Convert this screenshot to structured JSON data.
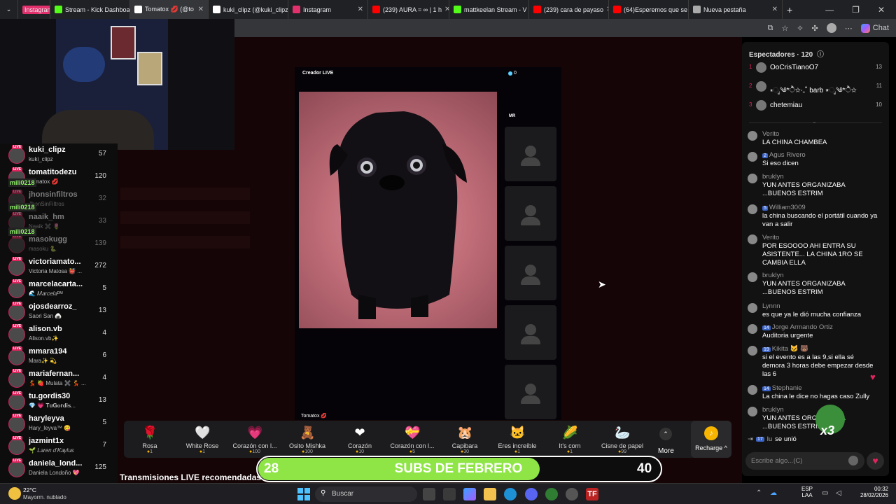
{
  "browser": {
    "tabs": [
      {
        "label": "Instagram",
        "color": "#e1306c",
        "badge": true
      },
      {
        "label": "Stream - Kick Dashboa",
        "color": "#53fc18"
      },
      {
        "label": "Tomatox 💋 (@to",
        "color": "#ffffff",
        "active": true
      },
      {
        "label": "kuki_clipz (@kuki_clipz",
        "color": "#ffffff"
      },
      {
        "label": "Instagram",
        "color": "#e1306c"
      },
      {
        "label": "(239) AURA = ∞ | 1 h",
        "color": "#ff0000"
      },
      {
        "label": "mattkeelan Stream - V",
        "color": "#53fc18"
      },
      {
        "label": "(239) cara de payaso",
        "color": "#ff0000"
      },
      {
        "label": "(64)Esperemos que se",
        "color": "#ff0000"
      },
      {
        "label": "Nueva pestaña",
        "color": "#aaaaaa"
      }
    ],
    "chat_button": "Chat"
  },
  "streamers": [
    {
      "name": "kuki_clipz",
      "sub": "kuki_clipz",
      "count": "57"
    },
    {
      "name": "tomatitodezu",
      "sub": "Tomatox 💋",
      "count": "120"
    },
    {
      "name": "jhonsinfiltros",
      "sub": "JhonSinFiltros",
      "count": "32",
      "dim": true
    },
    {
      "name": "naaik_hm",
      "sub": "Naaik ✖️ 🌷",
      "count": "33",
      "dim": true
    },
    {
      "name": "masokugg",
      "sub": "masoku 🐍",
      "count": "139",
      "dim": true
    },
    {
      "name": "victoriamato...",
      "sub": "Victoria Matosa 👹 ...",
      "count": "272"
    },
    {
      "name": "marcelacarta...",
      "sub": "🌊 𝑀𝑎𝑟𝑐𝑒𝑙𝑎ᴰᴹ",
      "count": "5"
    },
    {
      "name": "ojosdearroz_",
      "sub": "Saori San 🍙",
      "count": "13"
    },
    {
      "name": "alison.vb",
      "sub": "Alison.vb✨",
      "count": "4"
    },
    {
      "name": "mmara194",
      "sub": "Mara✨ 💫",
      "count": "6"
    },
    {
      "name": "mariafernan...",
      "sub": "💃 🍓 Mulata ✖️ 💃 ...",
      "count": "4"
    },
    {
      "name": "tu.gordis30",
      "sub": "💎 💗 𝐓𝐮𝐆𝐨𝐫𝐝𝐢𝐬...",
      "count": "13"
    },
    {
      "name": "haryleyva",
      "sub": "Hary_leyva™ 😋",
      "count": "5"
    },
    {
      "name": "jazmint1x",
      "sub": "🌱 𝐿𝑎𝑟𝑒𝑛 𝑑'𝐾𝑎𝑦𝑙𝑢𝑠",
      "count": "7"
    },
    {
      "name": "daniela_lond...",
      "sub": "Daniela Londoño 💖",
      "count": "125"
    }
  ],
  "overlay_user": "mili0218",
  "stream": {
    "creator_label": "Creador LIVE",
    "viewer_dot": "0",
    "host_name": "Tomatox 💋",
    "side_tag": "MR"
  },
  "gifts": [
    {
      "name": "Rosa",
      "price": "1",
      "icon": "🌹"
    },
    {
      "name": "White Rose",
      "price": "1",
      "icon": "🤍"
    },
    {
      "name": "Corazón con l...",
      "price": "100",
      "icon": "💗"
    },
    {
      "name": "Osito Mishka",
      "price": "100",
      "icon": "🧸"
    },
    {
      "name": "Corazón",
      "price": "10",
      "icon": "❤"
    },
    {
      "name": "Corazón con l...",
      "price": "5",
      "icon": "💝"
    },
    {
      "name": "Capibara",
      "price": "30",
      "icon": "🐹"
    },
    {
      "name": "Eres increíble",
      "price": "1",
      "icon": "🐱"
    },
    {
      "name": "It's corn",
      "price": "1",
      "icon": "🌽"
    },
    {
      "name": "Cisne de papel",
      "price": "99",
      "icon": "🦢"
    }
  ],
  "more_label": "More",
  "recharge_label": "Recharge ^",
  "subs_goal": {
    "current": "28",
    "label": "SUBS DE FEBRERO",
    "target": "40",
    "progress_fraction": 0.7
  },
  "recommended_label": "Transmisiones LIVE recomendadas",
  "chat": {
    "header": "Espectadores · 120",
    "top_viewers": [
      {
        "rank": "1",
        "name": "OoCrisTianoO7",
        "score": "13"
      },
      {
        "rank": "2",
        "name": "⭒ೃ༄*ੈ✩‧₊˚ barb ⭒ೃ༄*ੈ✩",
        "score": "11"
      },
      {
        "rank": "3",
        "name": "chetemiau",
        "score": "10"
      }
    ],
    "messages": [
      {
        "user": "Verito",
        "badge": "",
        "text": "LA CHINA CHAMBEA"
      },
      {
        "user": "Agus Rivero",
        "badge": "2",
        "text": "Si eso dicen"
      },
      {
        "user": "bruklyn",
        "badge": "",
        "text": "YUN ANTES ORGANIZABA ...BUENOS ESTRIM"
      },
      {
        "user": "William3009",
        "badge": "5",
        "text": "la china buscando el portátil cuando ya van a salir"
      },
      {
        "user": "Verito",
        "badge": "",
        "text": "POR ESOOOO AHI ENTRA SU ASISTENTE... LA CHINA 1RO SE CAMBIA ELLA"
      },
      {
        "user": "bruklyn",
        "badge": "",
        "text": "YUN ANTES ORGANIZABA ...BUENOS ESTRIM"
      },
      {
        "user": "Lynnn",
        "badge": "",
        "text": "es que ya le dió mucha confianza"
      },
      {
        "user": "Jorge Armando Ortiz",
        "badge": "14",
        "text": "Auditoria urgente"
      },
      {
        "user": "Kikita 🐱 🐻",
        "badge": "19",
        "text": "si el evento es a las 9,si ella sé demora 3 horas debe empezar desde las 6"
      },
      {
        "user": "Stephanie",
        "badge": "14",
        "text": "La china le dice no hagas caso Zully"
      },
      {
        "user": "bruklyn",
        "badge": "",
        "text": "YUN ANTES ORGANIZABA ...BUENOS ESTRIM"
      }
    ],
    "join_badge": "17",
    "join_user": "lu",
    "join_text": "se unió",
    "sticker_text": "x3",
    "input_placeholder": "Escribe algo...(C)"
  },
  "taskbar": {
    "weather_temp": "22°C",
    "weather_desc": "Mayorm. nublado",
    "search_placeholder": "Buscar",
    "lang": "ESP",
    "lang2": "LAA",
    "time": "00:32",
    "date": "28/02/2026"
  }
}
